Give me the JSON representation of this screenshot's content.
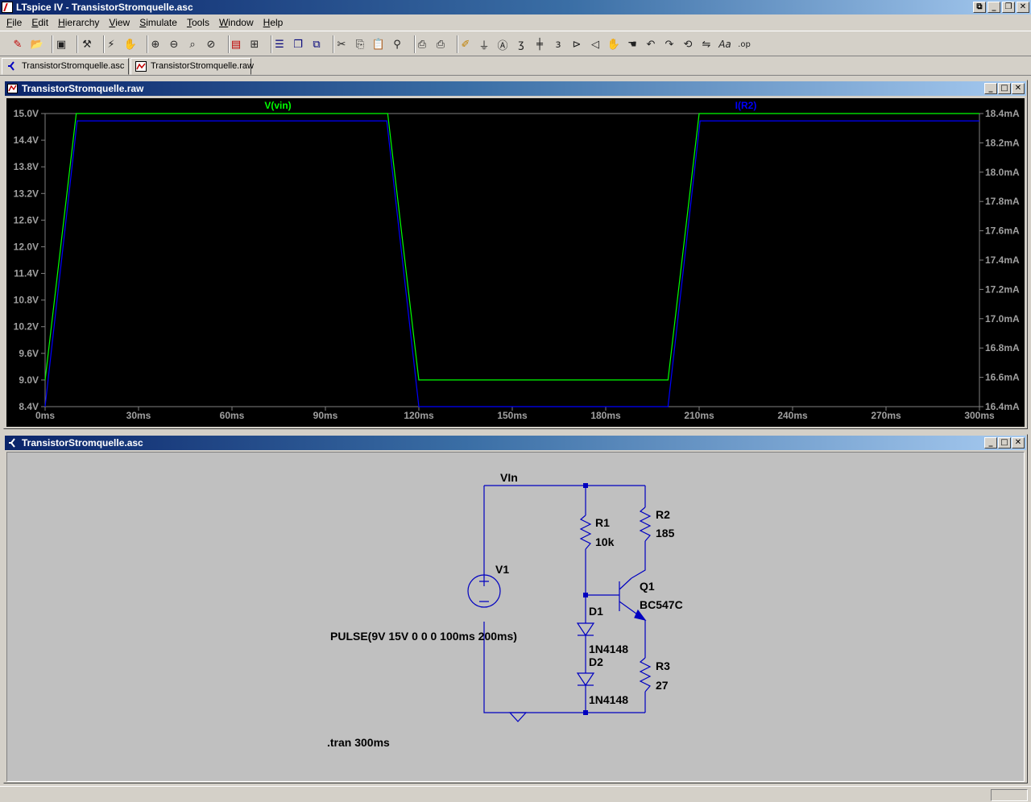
{
  "app": {
    "title": "LTspice IV - TransistorStromquelle.asc",
    "window_buttons": [
      "_",
      "❐",
      "✕"
    ]
  },
  "menu": [
    {
      "u": "F",
      "rest": "ile"
    },
    {
      "u": "E",
      "rest": "dit"
    },
    {
      "u": "H",
      "rest": "ierarchy"
    },
    {
      "u": "V",
      "rest": "iew"
    },
    {
      "u": "S",
      "rest": "imulate"
    },
    {
      "u": "T",
      "rest": "ools"
    },
    {
      "u": "W",
      "rest": "indow"
    },
    {
      "u": "H",
      "rest": "elp"
    }
  ],
  "toolbar_icons": [
    "new-schematic-icon",
    "open-icon",
    "save-icon",
    "control-panel-icon",
    "run-icon",
    "halt-icon",
    "zoom-in-icon",
    "zoom-out-icon",
    "zoom-fit-icon",
    "zoom-cancel-icon",
    "autorange-icon",
    "grid-icon",
    "tile-horizontal-icon",
    "cascade-icon",
    "tile-vertical-icon",
    "cut-icon",
    "copy-icon",
    "paste-icon",
    "find-icon",
    "print-setup-icon",
    "print-icon",
    "draw-wire-icon",
    "ground-icon",
    "label-net-icon",
    "resistor-icon",
    "capacitor-icon",
    "inductor-icon",
    "diode-icon",
    "component-icon",
    "move-icon",
    "drag-icon",
    "undo-icon",
    "redo-icon",
    "rotate-icon",
    "mirror-icon",
    "text-icon",
    "spice-directive-icon"
  ],
  "tabs": [
    {
      "label": "TransistorStromquelle.asc",
      "icon": "schematic-icon"
    },
    {
      "label": "TransistorStromquelle.raw",
      "icon": "waveform-icon"
    }
  ],
  "plot_window": {
    "title": "TransistorStromquelle.raw",
    "buttons": [
      "_",
      "□",
      "✕"
    ]
  },
  "schematic_window": {
    "title": "TransistorStromquelle.asc",
    "buttons": [
      "_",
      "□",
      "✕"
    ]
  },
  "chart_data": {
    "type": "line",
    "title": "",
    "xlabel": "",
    "x_ticks": [
      "0ms",
      "30ms",
      "60ms",
      "90ms",
      "120ms",
      "150ms",
      "180ms",
      "210ms",
      "240ms",
      "270ms",
      "300ms"
    ],
    "xlim": [
      0,
      300
    ],
    "y_left_ticks": [
      "15.0V",
      "14.4V",
      "13.8V",
      "13.2V",
      "12.6V",
      "12.0V",
      "11.4V",
      "10.8V",
      "10.2V",
      "9.6V",
      "9.0V",
      "8.4V"
    ],
    "ylim_left": [
      8.4,
      15.0
    ],
    "y_right_ticks": [
      "18.4mA",
      "18.2mA",
      "18.0mA",
      "17.8mA",
      "17.6mA",
      "17.4mA",
      "17.2mA",
      "17.0mA",
      "16.8mA",
      "16.6mA",
      "16.4mA"
    ],
    "ylim_right": [
      16.4,
      18.4
    ],
    "series": [
      {
        "name": "V(vin)",
        "axis": "left",
        "color": "#00ff00",
        "x": [
          0,
          10,
          110,
          120,
          200,
          210,
          300
        ],
        "y": [
          9.0,
          15.0,
          15.0,
          9.0,
          9.0,
          15.0,
          15.0
        ]
      },
      {
        "name": "I(R2)",
        "axis": "right",
        "color": "#0000ff",
        "x": [
          0,
          10.3,
          109.7,
          120,
          200,
          210.3,
          300
        ],
        "y": [
          16.4,
          18.35,
          18.35,
          16.4,
          16.4,
          18.35,
          18.35
        ]
      }
    ]
  },
  "schematic": {
    "net_label": "VIn",
    "components": {
      "R1": {
        "name": "R1",
        "value": "10k"
      },
      "R2": {
        "name": "R2",
        "value": "185"
      },
      "R3": {
        "name": "R3",
        "value": "27"
      },
      "V1": {
        "name": "V1",
        "value": "PULSE(9V 15V 0 0 0 100ms 200ms)"
      },
      "Q1": {
        "name": "Q1",
        "value": "BC547C"
      },
      "D1": {
        "name": "D1",
        "value": "1N4148"
      },
      "D2": {
        "name": "D2",
        "value": "1N4148"
      }
    },
    "directive": ".tran 300ms",
    "wire_color": "#0000c0",
    "label_color": "#000000"
  }
}
